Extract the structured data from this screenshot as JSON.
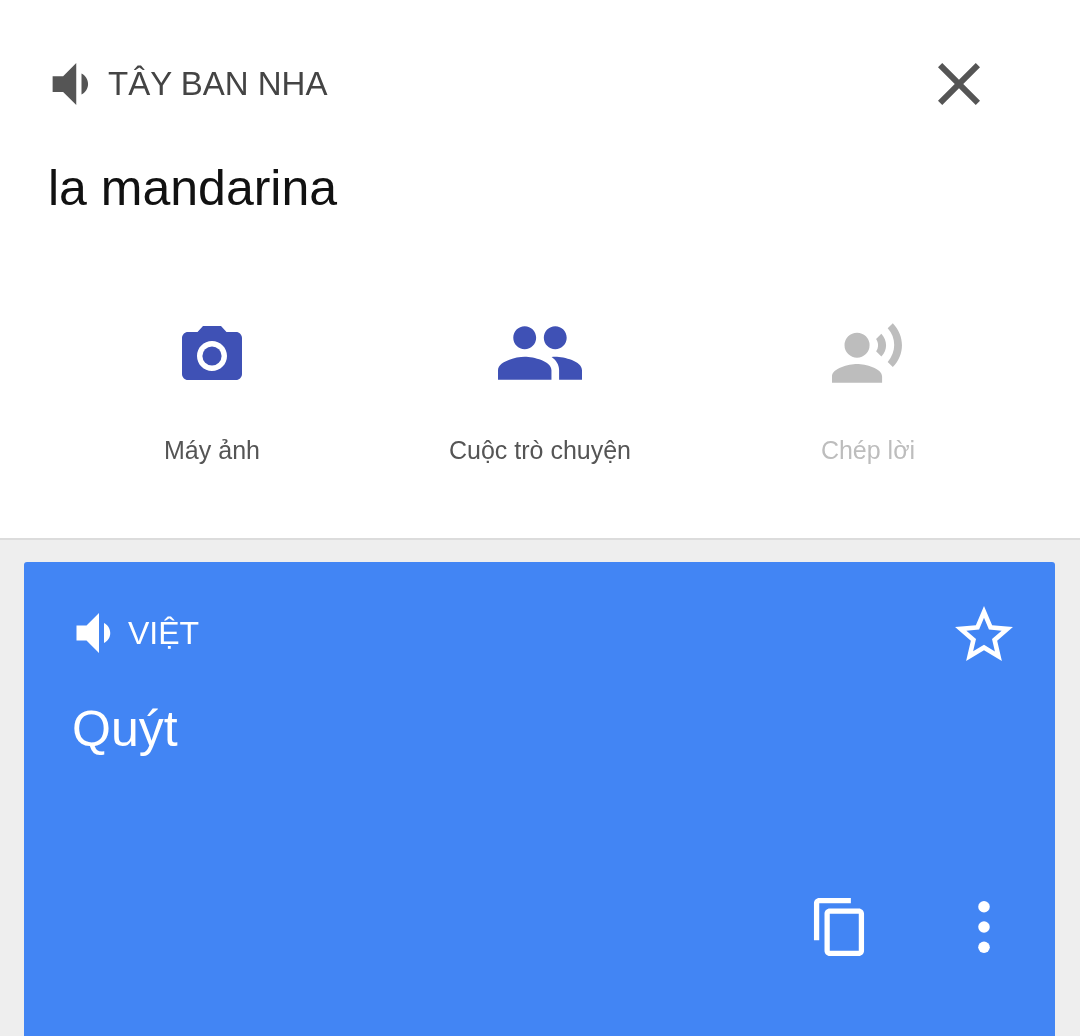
{
  "source": {
    "language": "TÂY BAN NHA",
    "text": "la mandarina"
  },
  "modes": [
    {
      "kind": "camera",
      "label": "Máy ảnh",
      "disabled": false
    },
    {
      "kind": "conversation",
      "label": "Cuộc trò chuyện",
      "disabled": false
    },
    {
      "kind": "transcribe",
      "label": "Chép lời",
      "disabled": true
    }
  ],
  "result": {
    "language": "VIỆT",
    "text": "Quýt",
    "starred": false
  }
}
